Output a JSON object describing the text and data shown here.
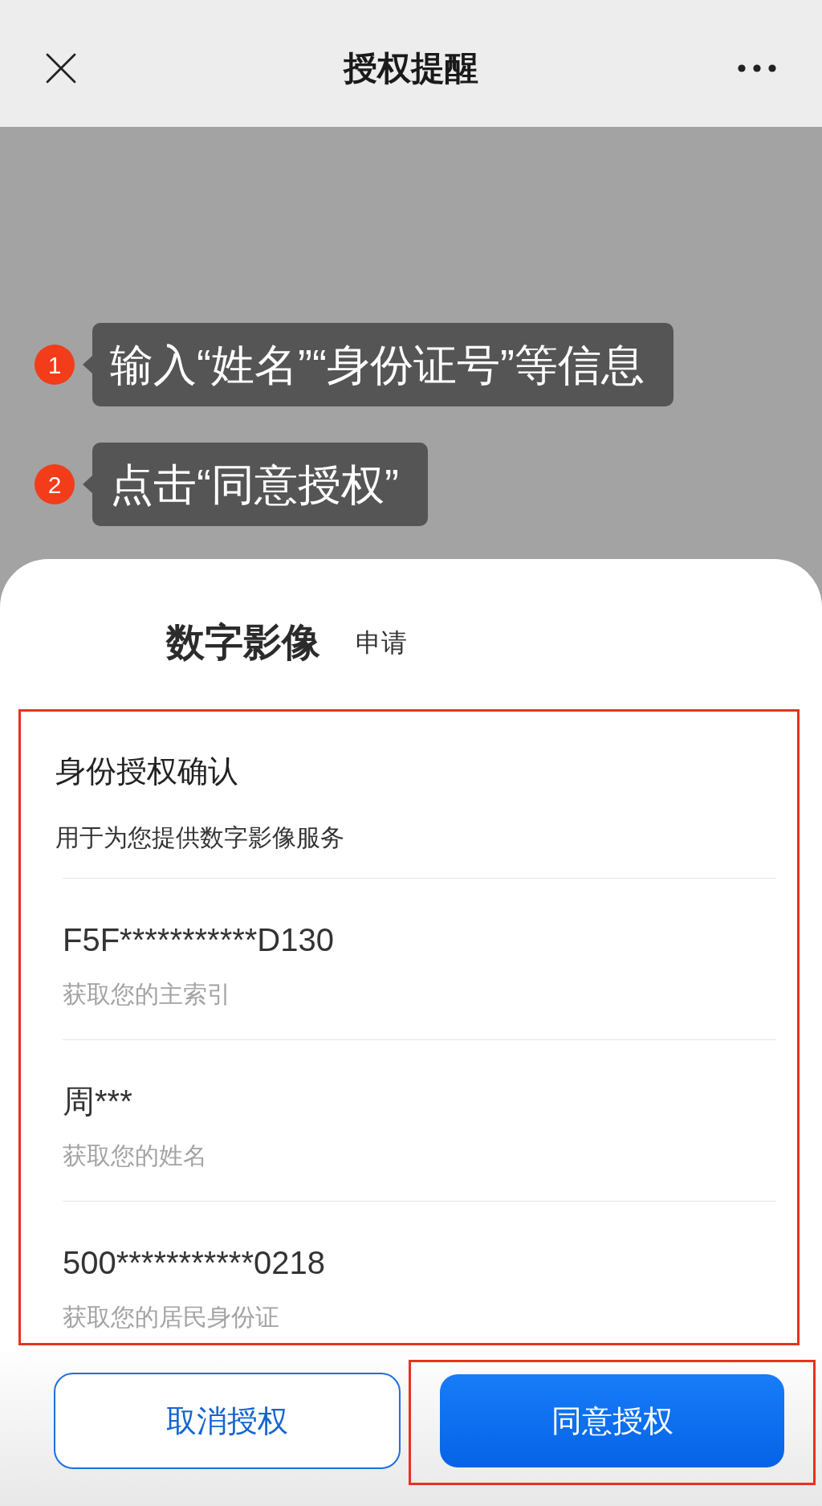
{
  "nav_bar": {
    "title": "授权提醒"
  },
  "tips": [
    {
      "badge": "1",
      "text": "输入“姓名”“身份证号”等信息"
    },
    {
      "badge": "2",
      "text": "点击“同意授权”"
    }
  ],
  "sheet": {
    "app_name": "数字影像",
    "action": "申请",
    "auth_card": {
      "highlighted": true,
      "title": "身份授权确认",
      "subtitle": "用于为您提供数字影像服务",
      "items": [
        {
          "value": "F5F***********D130",
          "description": "获取您的主索引"
        },
        {
          "value": "周***",
          "description": "获取您的姓名"
        },
        {
          "value": "500***********0218",
          "description": "获取您的居民身份证"
        }
      ]
    },
    "buttons": [
      {
        "kind": "outline",
        "label": "取消授权",
        "highlighted": false
      },
      {
        "kind": "primary",
        "label": "同意授权",
        "highlighted": true
      }
    ]
  }
}
